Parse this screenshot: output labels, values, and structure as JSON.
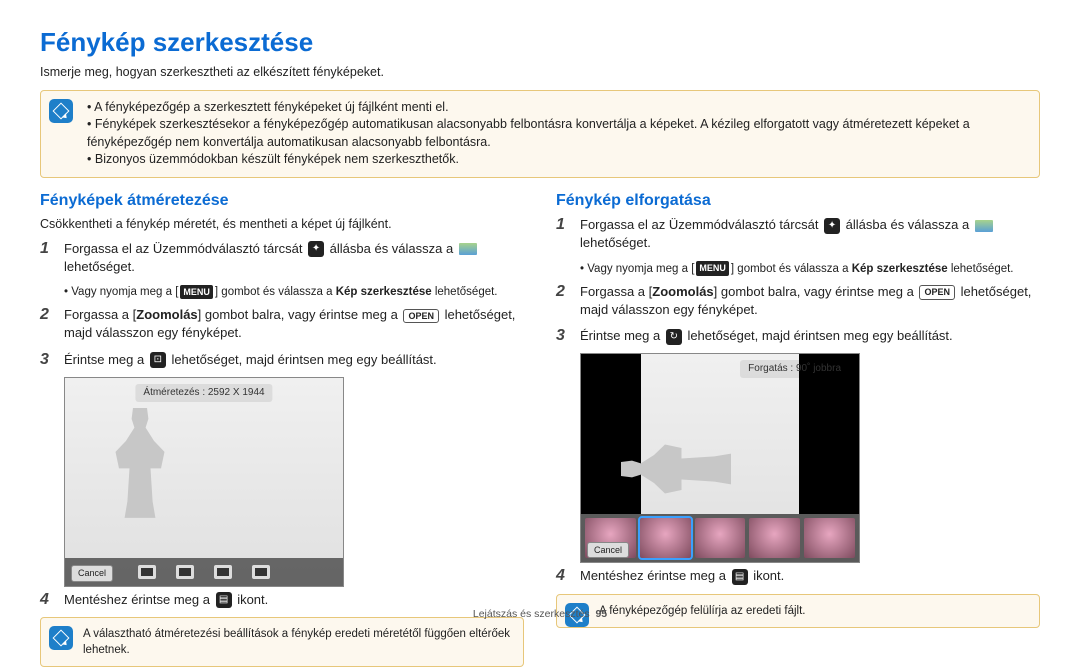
{
  "title": "Fénykép szerkesztése",
  "intro": "Ismerje meg, hogyan szerkesztheti az elkészített fényképeket.",
  "top_notes": [
    "A fényképezőgép a szerkesztett fényképeket új fájlként menti el.",
    "Fényképek szerkesztésekor a fényképezőgép automatikusan alacsonyabb felbontásra konvertálja a képeket. A kézileg elforgatott vagy átméretezett képeket a fényképezőgép nem konvertálja automatikusan alacsonyabb felbontásra.",
    "Bizonyos üzemmódokban készült fényképek nem szerkeszthetők."
  ],
  "left": {
    "heading": "Fényképek átméretezése",
    "sub": "Csökkentheti a fénykép méretét, és mentheti a képet új fájlként.",
    "step1a": "Forgassa el az Üzemmódválasztó tárcsát ",
    "step1b": " állásba és válassza a ",
    "step1c": " lehetőséget.",
    "step1_sub_a": "Vagy nyomja meg a [",
    "menu_label": "MENU",
    "step1_sub_b": "] gombot és válassza a ",
    "step1_sub_bold": "Kép szerkesztése",
    "step1_sub_c": " lehetőséget.",
    "step2a": "Forgassa a [",
    "zoom_label": "Zoomolás",
    "step2b": "] gombot balra, vagy érintse meg a ",
    "open_label": "OPEN",
    "step2c": " lehetőséget, majd válasszon egy fényképet.",
    "step3a": "Érintse meg a ",
    "step3b": " lehetőséget, majd érintsen meg egy beállítást.",
    "screen_title": "Átméretezés : 2592 X 1944",
    "cancel": "Cancel",
    "step4a": "Mentéshez érintse meg a ",
    "step4b": " ikont.",
    "bottom_note": "A választható átméretezési beállítások a fénykép eredeti méretétől függően eltérőek lehetnek."
  },
  "right": {
    "heading": "Fénykép elforgatása",
    "step1a": "Forgassa el az Üzemmódválasztó tárcsát ",
    "step1b": " állásba és válassza a ",
    "step1c": " lehetőséget.",
    "step1_sub_a": "Vagy nyomja meg a [",
    "menu_label": "MENU",
    "step1_sub_b": "] gombot és válassza a ",
    "step1_sub_bold": "Kép szerkesztése",
    "step1_sub_c": " lehetőséget.",
    "step2a": "Forgassa a [",
    "zoom_label": "Zoomolás",
    "step2b": "] gombot balra, vagy érintse meg a ",
    "open_label": "OPEN",
    "step2c": " lehetőséget, majd válasszon egy fényképet.",
    "step3a": "Érintse meg a ",
    "step3b": " lehetőséget, majd érintsen meg egy beállítást.",
    "screen_title": "Forgatás : 90˚ jobbra",
    "cancel": "Cancel",
    "step4a": "Mentéshez érintse meg a ",
    "step4b": " ikont.",
    "bottom_note": "A fényképezőgép felülírja az eredeti fájlt."
  },
  "footer_label": "Lejátszás és szerkesztés",
  "footer_page": "95",
  "icons": {
    "dpad": "✦",
    "resize": "⊡",
    "rotate": "↻",
    "save": "▤"
  }
}
